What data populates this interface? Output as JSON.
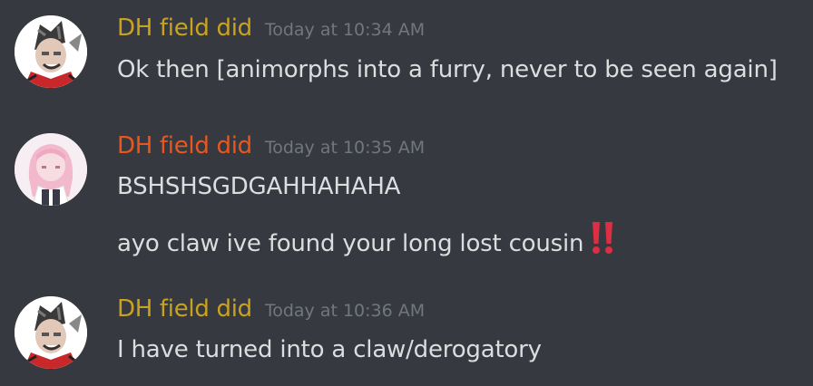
{
  "colors": {
    "background": "#36393f",
    "text": "#dcddde",
    "timestamp": "#72767d",
    "role_gold": "#c9a21f",
    "role_orange": "#e8581e",
    "emoji_red": "#dd2e44"
  },
  "messages": [
    {
      "username": "DH field did",
      "timestamp": "Today at 10:34 AM",
      "avatar": "gundham-avatar",
      "name_color": "#c9a21f",
      "lines": [
        "Ok then [animorphs into a furry, never to be seen again]"
      ]
    },
    {
      "username": "DH field did",
      "timestamp": "Today at 10:35 AM",
      "avatar": "pink-hair-avatar",
      "name_color": "#e8581e",
      "lines": [
        "BSHSHSGDGAHHAHAHA",
        "ayo claw ive found your long lost cousin"
      ],
      "emoji": "double-exclamation-mark"
    },
    {
      "username": "DH field did",
      "timestamp": "Today at 10:36 AM",
      "avatar": "gundham-avatar",
      "name_color": "#c9a21f",
      "lines": [
        "I have turned into a claw/derogatory"
      ]
    }
  ]
}
